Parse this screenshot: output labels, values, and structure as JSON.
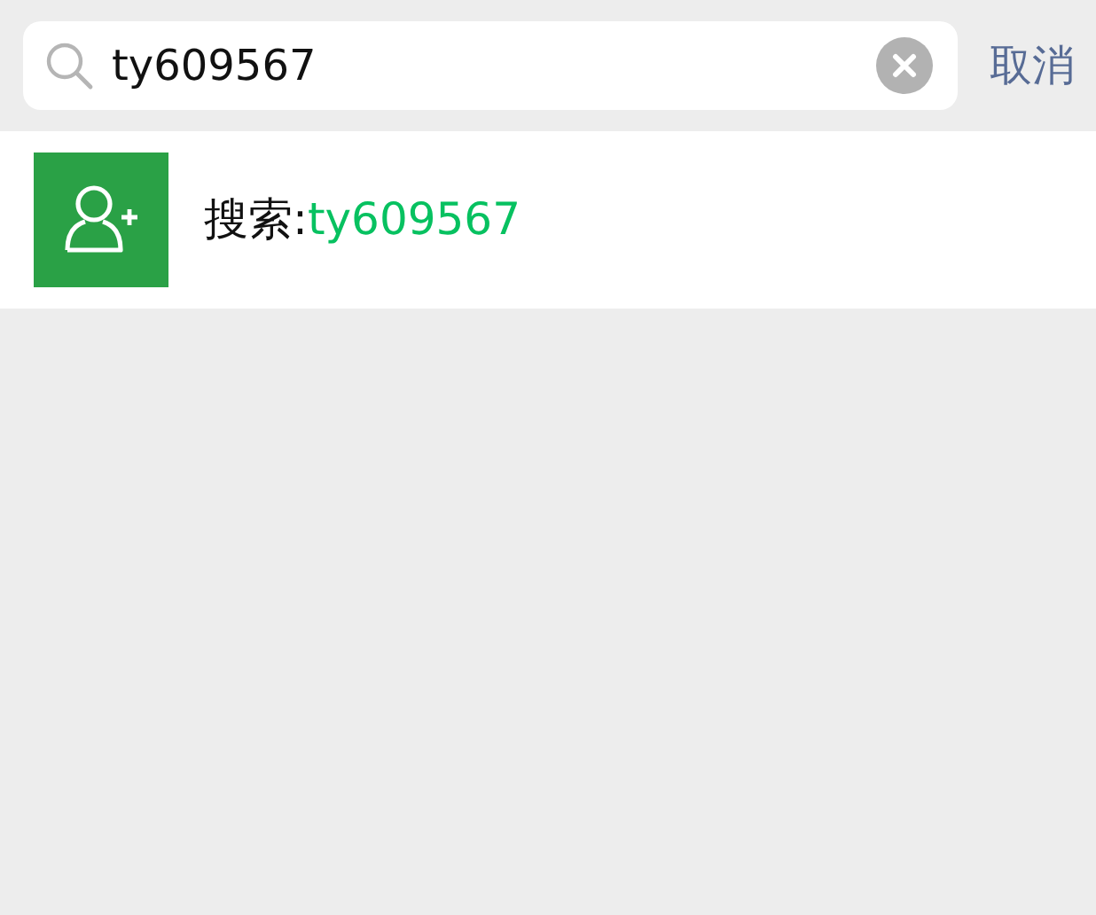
{
  "search": {
    "value": "ty609567"
  },
  "cancel_button": "取消",
  "result": {
    "label": "搜索:",
    "query": "ty609567"
  }
}
